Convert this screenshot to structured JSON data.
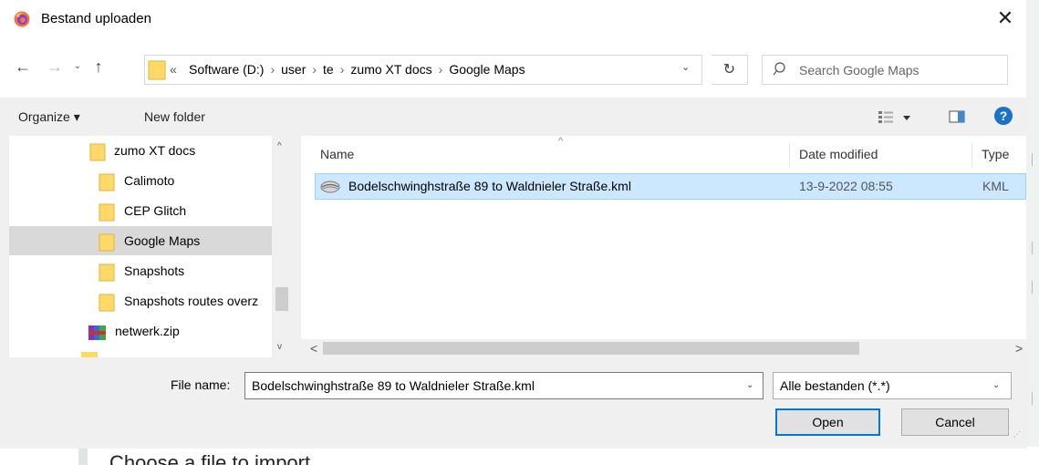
{
  "background": {
    "heading": "Choose a file to import"
  },
  "dialog": {
    "title": "Bestand uploaden",
    "close_glyph": "✕"
  },
  "navbar": {
    "back_glyph": "←",
    "forward_glyph": "→",
    "recent_glyph": "⌄",
    "up_glyph": "↑",
    "overflow_glyph": "«",
    "breadcrumbs": [
      "Software (D:)",
      "user",
      "te",
      "zumo XT docs",
      "Google Maps"
    ],
    "breadcrumb_sep": "›",
    "dropdown_glyph": "⌄",
    "refresh_glyph": "↻",
    "search_placeholder": "Search Google Maps"
  },
  "toolbar": {
    "organize_label": "Organize ▾",
    "new_folder_label": "New folder",
    "help_glyph": "?"
  },
  "tree": {
    "items": [
      {
        "label": "zumo XT docs",
        "icon": "folder-icon"
      },
      {
        "label": "Calimoto",
        "icon": "folder-icon"
      },
      {
        "label": "CEP Glitch",
        "icon": "folder-icon"
      },
      {
        "label": "Google Maps",
        "icon": "folder-icon",
        "selected": true
      },
      {
        "label": "Snapshots",
        "icon": "folder-icon"
      },
      {
        "label": "Snapshots routes overz",
        "icon": "folder-icon"
      },
      {
        "label": "netwerk.zip",
        "icon": "zip-archive-icon"
      }
    ],
    "scroll_up_glyph": "^",
    "scroll_down_glyph": "v"
  },
  "filelist": {
    "sort_glyph": "^",
    "columns": [
      "Name",
      "Date modified",
      "Type"
    ],
    "rows": [
      {
        "name": "Bodelschwinghstraße 89 to Waldnieler Straße.kml",
        "date_modified": "13-9-2022 08:55",
        "type": "KML",
        "icon": "kml-file-icon",
        "selected": true
      }
    ],
    "scroll_left_glyph": "<",
    "scroll_right_glyph": ">"
  },
  "bottom": {
    "file_name_label": "File name:",
    "file_name_value": "Bodelschwinghstraße 89 to Waldnieler Straße.kml",
    "filter_value": "Alle bestanden (*.*)",
    "dropdown_glyph": "⌄",
    "open_label": "Open",
    "cancel_label": "Cancel"
  },
  "colors": {
    "selection_bg": "#cce8ff",
    "selection_border": "#99d1ff",
    "folder": "#ffd966",
    "accent": "#0078d7",
    "help": "#1a73c8"
  }
}
